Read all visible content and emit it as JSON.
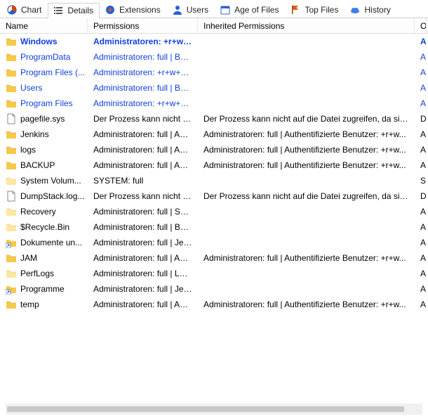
{
  "tabs": [
    {
      "id": "chart",
      "label": "Chart",
      "icon": "pie",
      "active": false
    },
    {
      "id": "details",
      "label": "Details",
      "icon": "list",
      "active": true
    },
    {
      "id": "extensions",
      "label": "Extensions",
      "icon": "puzzle",
      "active": false
    },
    {
      "id": "users",
      "label": "Users",
      "icon": "user",
      "active": false
    },
    {
      "id": "age",
      "label": "Age of Files",
      "icon": "calendar",
      "active": false
    },
    {
      "id": "top",
      "label": "Top Files",
      "icon": "flag",
      "active": false
    },
    {
      "id": "history",
      "label": "History",
      "icon": "cloud",
      "active": false
    }
  ],
  "columns": [
    "Name",
    "Permissions",
    "Inherited Permissions",
    "O"
  ],
  "rows": [
    {
      "name": "Windows",
      "icon": "folder",
      "style": "boldblue",
      "perms": "Administratoren: +r+w+...",
      "inh": "",
      "o": "A"
    },
    {
      "name": "ProgramData",
      "icon": "folder",
      "style": "blue",
      "perms": "Administratoren: full | Ben...",
      "inh": "",
      "o": "A"
    },
    {
      "name": "Program Files (...",
      "icon": "folder",
      "style": "blue",
      "perms": "Administratoren: +r+w+x ...",
      "inh": "",
      "o": "A"
    },
    {
      "name": "Users",
      "icon": "folder",
      "style": "blue",
      "perms": "Administratoren: full | Ben...",
      "inh": "",
      "o": "A"
    },
    {
      "name": "Program Files",
      "icon": "folder",
      "style": "blue",
      "perms": "Administratoren: +r+w+x ...",
      "inh": "",
      "o": "A"
    },
    {
      "name": "pagefile.sys",
      "icon": "file",
      "style": "",
      "perms": "Der Prozess kann nicht au...",
      "inh": "Der Prozess kann nicht auf die Datei zugreifen, da sie v...",
      "o": "D"
    },
    {
      "name": "Jenkins",
      "icon": "folder",
      "style": "",
      "perms": "Administratoren: full | Aut...",
      "inh": "Administratoren: full | Authentifizierte Benutzer: +r+w...",
      "o": "A"
    },
    {
      "name": "logs",
      "icon": "folder",
      "style": "",
      "perms": "Administratoren: full | Aut...",
      "inh": "Administratoren: full | Authentifizierte Benutzer: +r+w...",
      "o": "A"
    },
    {
      "name": "BACKUP",
      "icon": "folder",
      "style": "",
      "perms": "Administratoren: full | Aut...",
      "inh": "Administratoren: full | Authentifizierte Benutzer: +r+w...",
      "o": "A"
    },
    {
      "name": "System Volum...",
      "icon": "folder-light",
      "style": "",
      "perms": "SYSTEM: full",
      "inh": "",
      "o": "S"
    },
    {
      "name": "DumpStack.log...",
      "icon": "file",
      "style": "",
      "perms": "Der Prozess kann nicht au...",
      "inh": "Der Prozess kann nicht auf die Datei zugreifen, da sie v...",
      "o": "D"
    },
    {
      "name": "Recovery",
      "icon": "folder-light",
      "style": "",
      "perms": "Administratoren: full | SYS...",
      "inh": "",
      "o": "A"
    },
    {
      "name": "$Recycle.Bin",
      "icon": "folder-light",
      "style": "",
      "perms": "Administratoren: full | Ben...",
      "inh": "",
      "o": "A"
    },
    {
      "name": "Dokumente un...",
      "icon": "shortcut",
      "style": "",
      "perms": "Administratoren: full | Jed...",
      "inh": "",
      "o": "A"
    },
    {
      "name": "JAM",
      "icon": "folder",
      "style": "",
      "perms": "Administratoren: full | Aut...",
      "inh": "Administratoren: full | Authentifizierte Benutzer: +r+w...",
      "o": "A"
    },
    {
      "name": "PerfLogs",
      "icon": "folder-light",
      "style": "",
      "perms": "Administratoren: full | Leis...",
      "inh": "",
      "o": "A"
    },
    {
      "name": "Programme",
      "icon": "shortcut",
      "style": "",
      "perms": "Administratoren: full | Jed...",
      "inh": "",
      "o": "A"
    },
    {
      "name": "temp",
      "icon": "folder",
      "style": "",
      "perms": "Administratoren: full | Aut...",
      "inh": "Administratoren: full | Authentifizierte Benutzer: +r+w...",
      "o": "A"
    }
  ]
}
